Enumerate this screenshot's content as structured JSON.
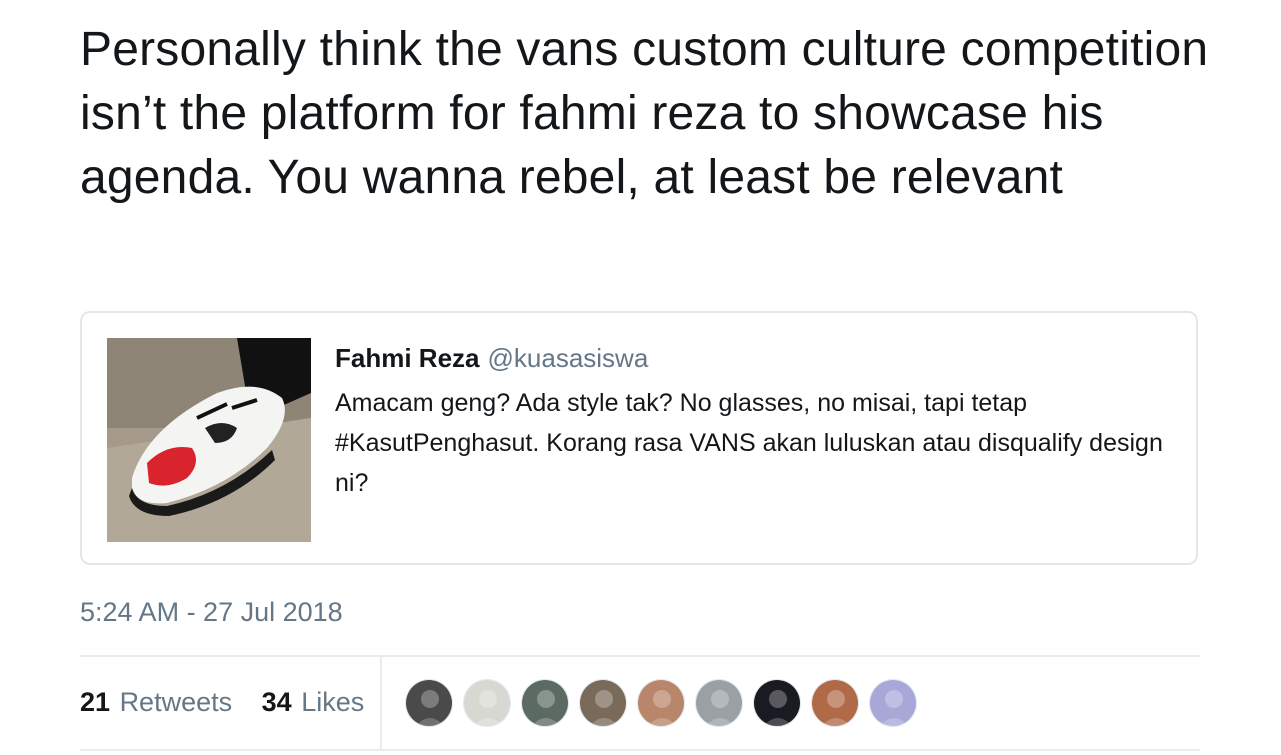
{
  "tweet": {
    "text": "Personally think the vans custom culture competition isn’t the platform for fahmi reza to showcase his agenda. You wanna rebel, at least be relevant",
    "timestamp": "5:24 AM - 27 Jul 2018"
  },
  "quoted_tweet": {
    "author_name": "Fahmi Reza",
    "author_handle": "@kuasasiswa",
    "text": "Amacam geng? Ada style tak? No glasses, no misai, tapi tetap #KasutPenghasut. Korang rasa VANS akan luluskan atau disqualify design ni?"
  },
  "stats": {
    "retweets_count": "21",
    "retweets_label": "Retweets",
    "likes_count": "34",
    "likes_label": "Likes"
  },
  "liker_avatars": [
    {
      "icon": "avatar-icon",
      "color": "#4a4a4a"
    },
    {
      "icon": "avatar-icon",
      "color": "#d8d8d2"
    },
    {
      "icon": "avatar-icon",
      "color": "#5c6b62"
    },
    {
      "icon": "avatar-icon",
      "color": "#7a6a5a"
    },
    {
      "icon": "avatar-icon",
      "color": "#b8866a"
    },
    {
      "icon": "avatar-icon",
      "color": "#9aa0a3"
    },
    {
      "icon": "avatar-icon",
      "color": "#1a1a22"
    },
    {
      "icon": "avatar-icon",
      "color": "#b06a48"
    },
    {
      "icon": "avatar-icon",
      "color": "#a9a6d8"
    }
  ],
  "colors": {
    "text": "#14171a",
    "secondary": "#657786",
    "border": "#e1e8ed"
  }
}
